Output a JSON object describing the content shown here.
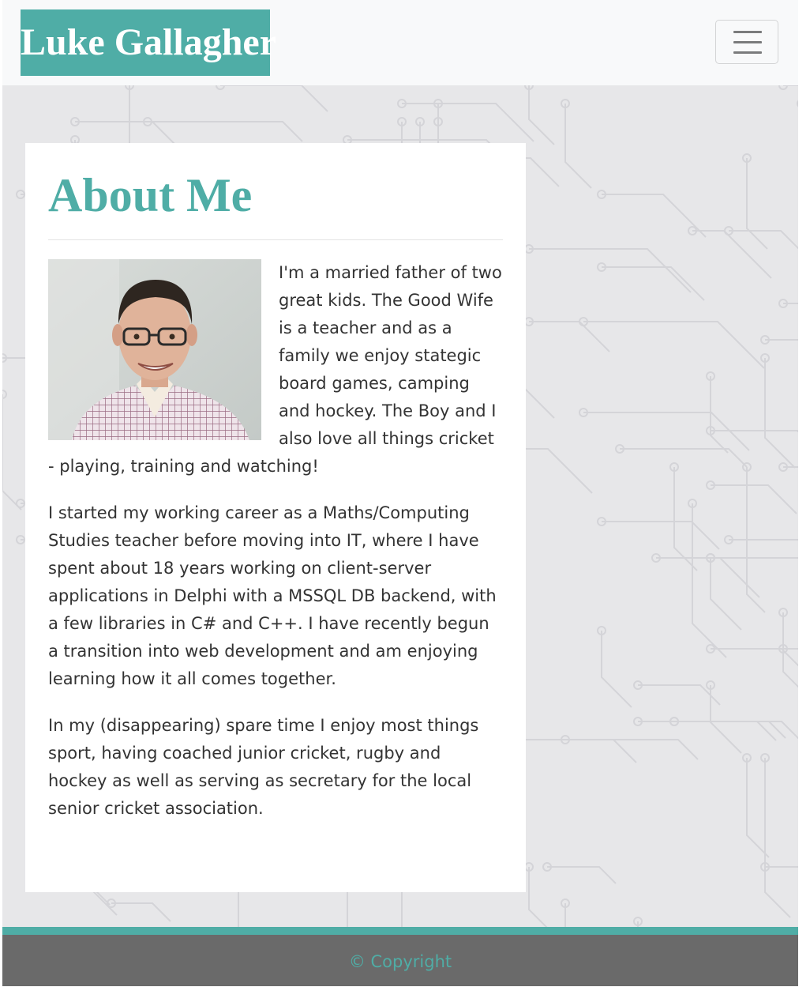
{
  "navbar": {
    "brand": "Luke Gallagher",
    "brand_color": "#4fada6",
    "toggle_icon": "hamburger-menu-icon"
  },
  "about": {
    "heading": "About Me",
    "heading_color": "#4fada6",
    "photo_icon": "profile-photo",
    "paragraphs": [
      "I'm a married father of two great kids. The Good Wife is a teacher and as a family we enjoy stategic board games, camping and hockey. The Boy and I also love all things cricket - playing, training and watching!",
      "I started my working career as a Maths/Computing Studies teacher before moving into IT, where I have spent about 18 years working on client-server applications in Delphi with a MSSQL DB backend, with a few libraries in C# and C++. I have recently begun a transition into web development and am enjoying learning how it all comes together.",
      "In my (disappearing) spare time I enjoy most things sport, having coached junior cricket, rugby and hockey as well as serving as secretary for the local senior cricket association."
    ]
  },
  "footer": {
    "copyright": "© Copyright",
    "background": "#6a6a6a",
    "accent": "#4fada6"
  }
}
